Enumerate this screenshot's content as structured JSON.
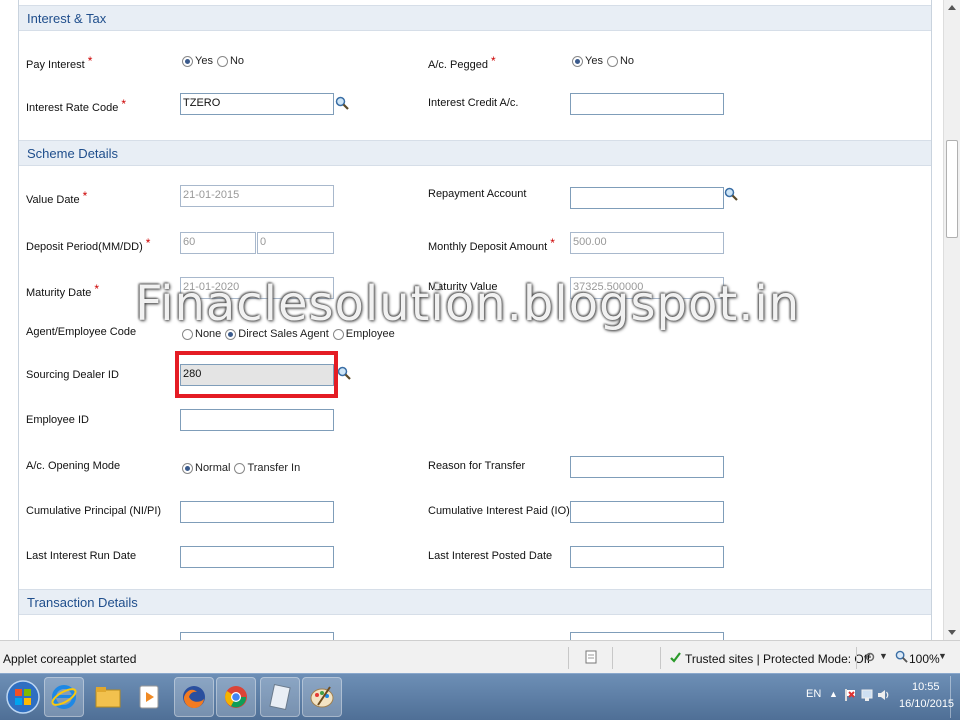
{
  "sections": {
    "interest_tax": "Interest & Tax",
    "scheme_details": "Scheme Details",
    "transaction_details": "Transaction Details"
  },
  "fields": {
    "pay_interest": {
      "label": "Pay Interest",
      "options": [
        "Yes",
        "No"
      ],
      "selected": "Yes"
    },
    "ac_pegged": {
      "label": "A/c. Pegged",
      "options": [
        "Yes",
        "No"
      ],
      "selected": "Yes"
    },
    "interest_rate_code": {
      "label": "Interest Rate Code",
      "value": "TZERO"
    },
    "interest_credit_ac": {
      "label": "Interest Credit A/c.",
      "value": ""
    },
    "value_date": {
      "label": "Value Date",
      "value": "21-01-2015"
    },
    "repayment_account": {
      "label": "Repayment Account",
      "value": ""
    },
    "deposit_period": {
      "label": "Deposit Period(MM/DD)",
      "months": "60",
      "days": "0"
    },
    "monthly_deposit_amount": {
      "label": "Monthly Deposit Amount",
      "value": "500.00"
    },
    "maturity_date": {
      "label": "Maturity Date",
      "value": "21-01-2020"
    },
    "maturity_value": {
      "label": "Maturity Value",
      "value": "37325.500000"
    },
    "agent_employee_code": {
      "label": "Agent/Employee Code",
      "options": [
        "None",
        "Direct Sales Agent",
        "Employee"
      ],
      "selected": "Direct Sales Agent"
    },
    "sourcing_dealer_id": {
      "label": "Sourcing Dealer ID",
      "value": "280"
    },
    "employee_id": {
      "label": "Employee ID",
      "value": ""
    },
    "ac_opening_mode": {
      "label": "A/c. Opening Mode",
      "options": [
        "Normal",
        "Transfer In"
      ],
      "selected": "Normal"
    },
    "reason_for_transfer": {
      "label": "Reason for Transfer",
      "value": ""
    },
    "cumulative_principal": {
      "label": "Cumulative Principal (NI/PI)",
      "value": ""
    },
    "cumulative_interest_paid": {
      "label": "Cumulative Interest Paid (IO)",
      "value": ""
    },
    "last_interest_run_date": {
      "label": "Last Interest Run Date",
      "value": ""
    },
    "last_interest_posted_date": {
      "label": "Last Interest Posted Date",
      "value": ""
    }
  },
  "required_mark": "*",
  "watermark": "Finaclesolution.blogspot.in",
  "statusbar": {
    "message": "Applet coreapplet started",
    "zone": "Trusted sites | Protected Mode: Off",
    "zoom": "100%"
  },
  "tray": {
    "lang": "EN",
    "time": "10:55",
    "date": "16/10/2015"
  },
  "colors": {
    "section_bar": "#e8eef5",
    "section_text": "#1f4e8c",
    "highlight": "#e41c24",
    "taskbar": "#5a7ba3"
  }
}
